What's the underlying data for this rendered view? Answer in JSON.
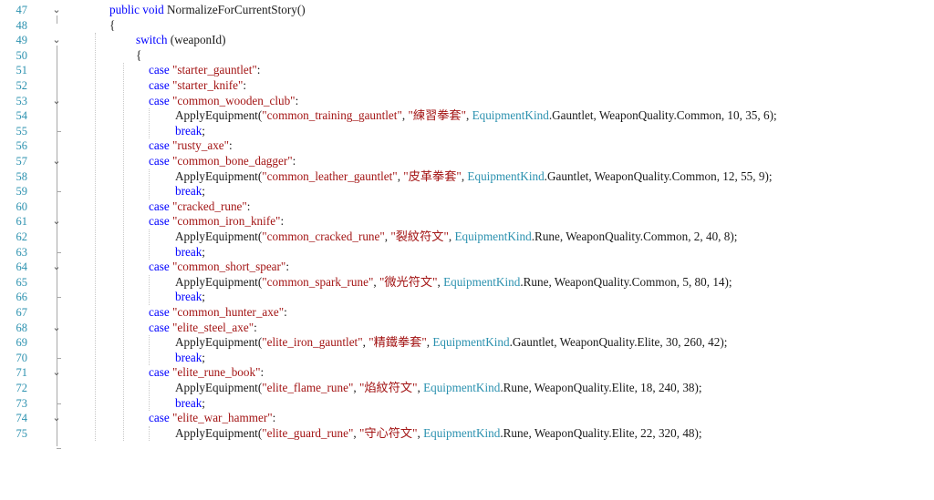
{
  "editor": {
    "lines": [
      {
        "num": "47",
        "fold": true,
        "segs": [
          {
            "t": "public void ",
            "c": "kw"
          },
          {
            "t": "NormalizeForCurrentStory()",
            "c": "plain"
          }
        ]
      },
      {
        "num": "48",
        "segs": [
          {
            "t": "{",
            "c": "plain"
          }
        ]
      },
      {
        "num": "49",
        "fold": true,
        "segs": [
          {
            "t": "switch ",
            "c": "kw"
          },
          {
            "t": "(weaponId)",
            "c": "plain"
          }
        ]
      },
      {
        "num": "50",
        "segs": [
          {
            "t": "{",
            "c": "plain"
          }
        ]
      },
      {
        "num": "51",
        "segs": [
          {
            "t": "case ",
            "c": "kw"
          },
          {
            "t": "\"starter_gauntlet\"",
            "c": "str"
          },
          {
            "t": ":",
            "c": "plain"
          }
        ]
      },
      {
        "num": "52",
        "segs": [
          {
            "t": "case ",
            "c": "kw"
          },
          {
            "t": "\"starter_knife\"",
            "c": "str"
          },
          {
            "t": ":",
            "c": "plain"
          }
        ]
      },
      {
        "num": "53",
        "fold": true,
        "segs": [
          {
            "t": "case ",
            "c": "kw"
          },
          {
            "t": "\"common_wooden_club\"",
            "c": "str"
          },
          {
            "t": ":",
            "c": "plain"
          }
        ]
      },
      {
        "num": "54",
        "segs": [
          {
            "t": "ApplyEquipment(",
            "c": "plain"
          },
          {
            "t": "\"common_training_gauntlet\"",
            "c": "str"
          },
          {
            "t": ", ",
            "c": "plain"
          },
          {
            "t": "\"練習拳套\"",
            "c": "str"
          },
          {
            "t": ", ",
            "c": "plain"
          },
          {
            "t": "EquipmentKind",
            "c": "typ"
          },
          {
            "t": ".Gauntlet, WeaponQuality.Common, 10, 35, 6);",
            "c": "plain"
          }
        ]
      },
      {
        "num": "55",
        "segs": [
          {
            "t": "break",
            "c": "kw"
          },
          {
            "t": ";",
            "c": "plain"
          }
        ]
      },
      {
        "num": "56",
        "segs": [
          {
            "t": "case ",
            "c": "kw"
          },
          {
            "t": "\"rusty_axe\"",
            "c": "str"
          },
          {
            "t": ":",
            "c": "plain"
          }
        ]
      },
      {
        "num": "57",
        "fold": true,
        "segs": [
          {
            "t": "case ",
            "c": "kw"
          },
          {
            "t": "\"common_bone_dagger\"",
            "c": "str"
          },
          {
            "t": ":",
            "c": "plain"
          }
        ]
      },
      {
        "num": "58",
        "segs": [
          {
            "t": "ApplyEquipment(",
            "c": "plain"
          },
          {
            "t": "\"common_leather_gauntlet\"",
            "c": "str"
          },
          {
            "t": ", ",
            "c": "plain"
          },
          {
            "t": "\"皮革拳套\"",
            "c": "str"
          },
          {
            "t": ", ",
            "c": "plain"
          },
          {
            "t": "EquipmentKind",
            "c": "typ"
          },
          {
            "t": ".Gauntlet, WeaponQuality.Common, 12, 55, 9);",
            "c": "plain"
          }
        ]
      },
      {
        "num": "59",
        "segs": [
          {
            "t": "break",
            "c": "kw"
          },
          {
            "t": ";",
            "c": "plain"
          }
        ]
      },
      {
        "num": "60",
        "segs": [
          {
            "t": "case ",
            "c": "kw"
          },
          {
            "t": "\"cracked_rune\"",
            "c": "str"
          },
          {
            "t": ":",
            "c": "plain"
          }
        ]
      },
      {
        "num": "61",
        "fold": true,
        "segs": [
          {
            "t": "case ",
            "c": "kw"
          },
          {
            "t": "\"common_iron_knife\"",
            "c": "str"
          },
          {
            "t": ":",
            "c": "plain"
          }
        ]
      },
      {
        "num": "62",
        "segs": [
          {
            "t": "ApplyEquipment(",
            "c": "plain"
          },
          {
            "t": "\"common_cracked_rune\"",
            "c": "str"
          },
          {
            "t": ", ",
            "c": "plain"
          },
          {
            "t": "\"裂紋符文\"",
            "c": "str"
          },
          {
            "t": ", ",
            "c": "plain"
          },
          {
            "t": "EquipmentKind",
            "c": "typ"
          },
          {
            "t": ".Rune, WeaponQuality.Common, 2, 40, 8);",
            "c": "plain"
          }
        ]
      },
      {
        "num": "63",
        "segs": [
          {
            "t": "break",
            "c": "kw"
          },
          {
            "t": ";",
            "c": "plain"
          }
        ]
      },
      {
        "num": "64",
        "fold": true,
        "segs": [
          {
            "t": "case ",
            "c": "kw"
          },
          {
            "t": "\"common_short_spear\"",
            "c": "str"
          },
          {
            "t": ":",
            "c": "plain"
          }
        ]
      },
      {
        "num": "65",
        "segs": [
          {
            "t": "ApplyEquipment(",
            "c": "plain"
          },
          {
            "t": "\"common_spark_rune\"",
            "c": "str"
          },
          {
            "t": ", ",
            "c": "plain"
          },
          {
            "t": "\"微光符文\"",
            "c": "str"
          },
          {
            "t": ", ",
            "c": "plain"
          },
          {
            "t": "EquipmentKind",
            "c": "typ"
          },
          {
            "t": ".Rune, WeaponQuality.Common, 5, 80, 14);",
            "c": "plain"
          }
        ]
      },
      {
        "num": "66",
        "segs": [
          {
            "t": "break",
            "c": "kw"
          },
          {
            "t": ";",
            "c": "plain"
          }
        ]
      },
      {
        "num": "67",
        "segs": [
          {
            "t": "case ",
            "c": "kw"
          },
          {
            "t": "\"common_hunter_axe\"",
            "c": "str"
          },
          {
            "t": ":",
            "c": "plain"
          }
        ]
      },
      {
        "num": "68",
        "fold": true,
        "segs": [
          {
            "t": "case ",
            "c": "kw"
          },
          {
            "t": "\"elite_steel_axe\"",
            "c": "str"
          },
          {
            "t": ":",
            "c": "plain"
          }
        ]
      },
      {
        "num": "69",
        "segs": [
          {
            "t": "ApplyEquipment(",
            "c": "plain"
          },
          {
            "t": "\"elite_iron_gauntlet\"",
            "c": "str"
          },
          {
            "t": ", ",
            "c": "plain"
          },
          {
            "t": "\"精鐵拳套\"",
            "c": "str"
          },
          {
            "t": ", ",
            "c": "plain"
          },
          {
            "t": "EquipmentKind",
            "c": "typ"
          },
          {
            "t": ".Gauntlet, WeaponQuality.Elite, 30, 260, 42);",
            "c": "plain"
          }
        ]
      },
      {
        "num": "70",
        "segs": [
          {
            "t": "break",
            "c": "kw"
          },
          {
            "t": ";",
            "c": "plain"
          }
        ]
      },
      {
        "num": "71",
        "fold": true,
        "segs": [
          {
            "t": "case ",
            "c": "kw"
          },
          {
            "t": "\"elite_rune_book\"",
            "c": "str"
          },
          {
            "t": ":",
            "c": "plain"
          }
        ]
      },
      {
        "num": "72",
        "segs": [
          {
            "t": "ApplyEquipment(",
            "c": "plain"
          },
          {
            "t": "\"elite_flame_rune\"",
            "c": "str"
          },
          {
            "t": ", ",
            "c": "plain"
          },
          {
            "t": "\"焰紋符文\"",
            "c": "str"
          },
          {
            "t": ", ",
            "c": "plain"
          },
          {
            "t": "EquipmentKind",
            "c": "typ"
          },
          {
            "t": ".Rune, WeaponQuality.Elite, 18, 240, 38);",
            "c": "plain"
          }
        ]
      },
      {
        "num": "73",
        "segs": [
          {
            "t": "break",
            "c": "kw"
          },
          {
            "t": ";",
            "c": "plain"
          }
        ]
      },
      {
        "num": "74",
        "fold": true,
        "segs": [
          {
            "t": "case ",
            "c": "kw"
          },
          {
            "t": "\"elite_war_hammer\"",
            "c": "str"
          },
          {
            "t": ":",
            "c": "plain"
          }
        ]
      },
      {
        "num": "75",
        "segs": [
          {
            "t": "ApplyEquipment(",
            "c": "plain"
          },
          {
            "t": "\"elite_guard_rune\"",
            "c": "str"
          },
          {
            "t": ", ",
            "c": "plain"
          },
          {
            "t": "\"守心符文\"",
            "c": "str"
          },
          {
            "t": ", ",
            "c": "plain"
          },
          {
            "t": "EquipmentKind",
            "c": "typ"
          },
          {
            "t": ".Rune, WeaponQuality.Elite, 22, 320, 48);",
            "c": "plain"
          }
        ]
      }
    ],
    "fold_icon": "chevron-down-icon"
  }
}
